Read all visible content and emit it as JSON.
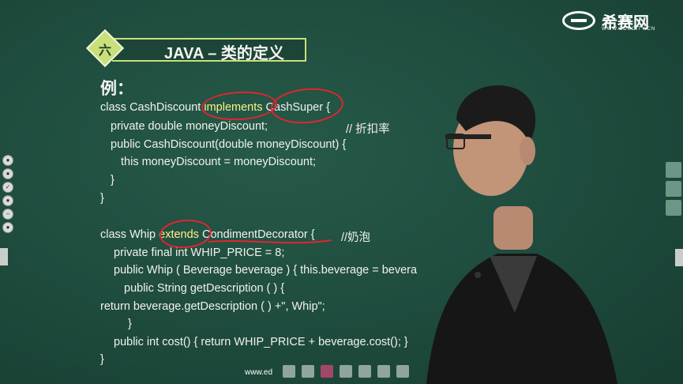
{
  "header": {
    "section_number": "六",
    "title": "JAVA – 类的定义"
  },
  "logo": {
    "name": "希赛网",
    "url": "WWW.EDUCITY.CN"
  },
  "example_label": "例：",
  "code": {
    "l1_pre": "class CashDiscount ",
    "l1_kw": "implements",
    "l1_post": " CashSuper {",
    "l2": "private double moneyDiscount;",
    "l2_comment": "// 折扣率",
    "l3": "public CashDiscount(double moneyDiscount) {",
    "l4": "this moneyDiscount = moneyDiscount;",
    "l5": "}",
    "l6": "}",
    "l7_pre": "class Whip ",
    "l7_kw": "extends",
    "l7_post": " CondimentDecorator {",
    "l7_comment": "//奶泡",
    "l8": "private final int WHIP_PRICE = 8;",
    "l9": "public Whip ( Beverage beverage ) { this.beverage = bevera",
    "l10": "public String getDescription ( ) {",
    "l11": "return beverage.getDescription ( ) +\", Whip\";",
    "l12": "}",
    "l13": "public int cost() { return WHIP_PRICE + beverage.cost(); }",
    "l14": "}"
  },
  "footer": {
    "url": "www.ed"
  },
  "colors": {
    "board": "#1e4b3d",
    "accent": "#c9e07a",
    "annotation": "#e0262f",
    "highlight": "#fff08a"
  }
}
